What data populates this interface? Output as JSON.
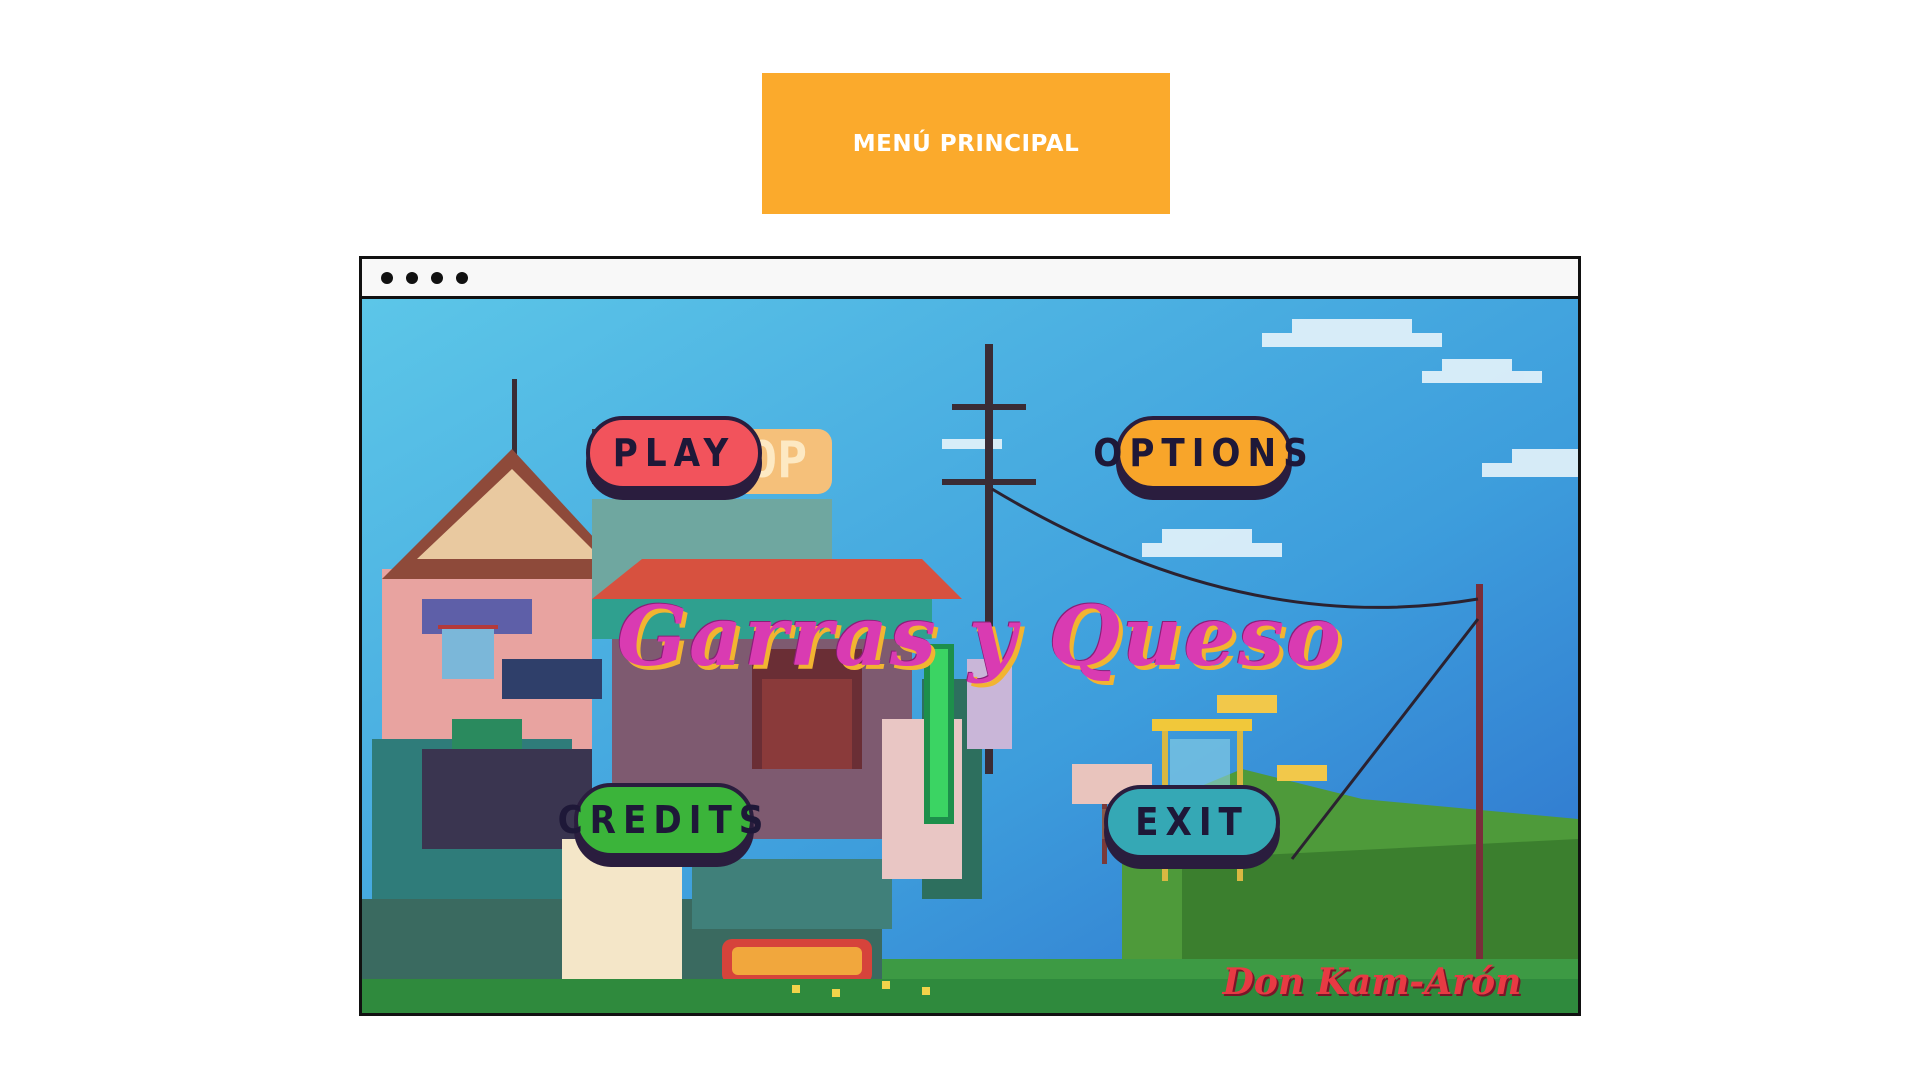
{
  "header": {
    "banner_label": "MENÚ PRINCIPAL"
  },
  "game": {
    "title": "Garras y Queso",
    "author": "Don Kam-Arón",
    "buttons": {
      "play": "PLAY",
      "options": "OPTIONS",
      "credits": "CREDITS",
      "exit": "EXIT"
    },
    "shop_sign": "SHOP"
  },
  "colors": {
    "banner": "#FBAA2C",
    "play": "#F2535C",
    "options": "#F8A52A",
    "credits": "#3BB43A",
    "exit": "#35A8B5",
    "title": "#D93BB2",
    "author": "#E83A43"
  }
}
